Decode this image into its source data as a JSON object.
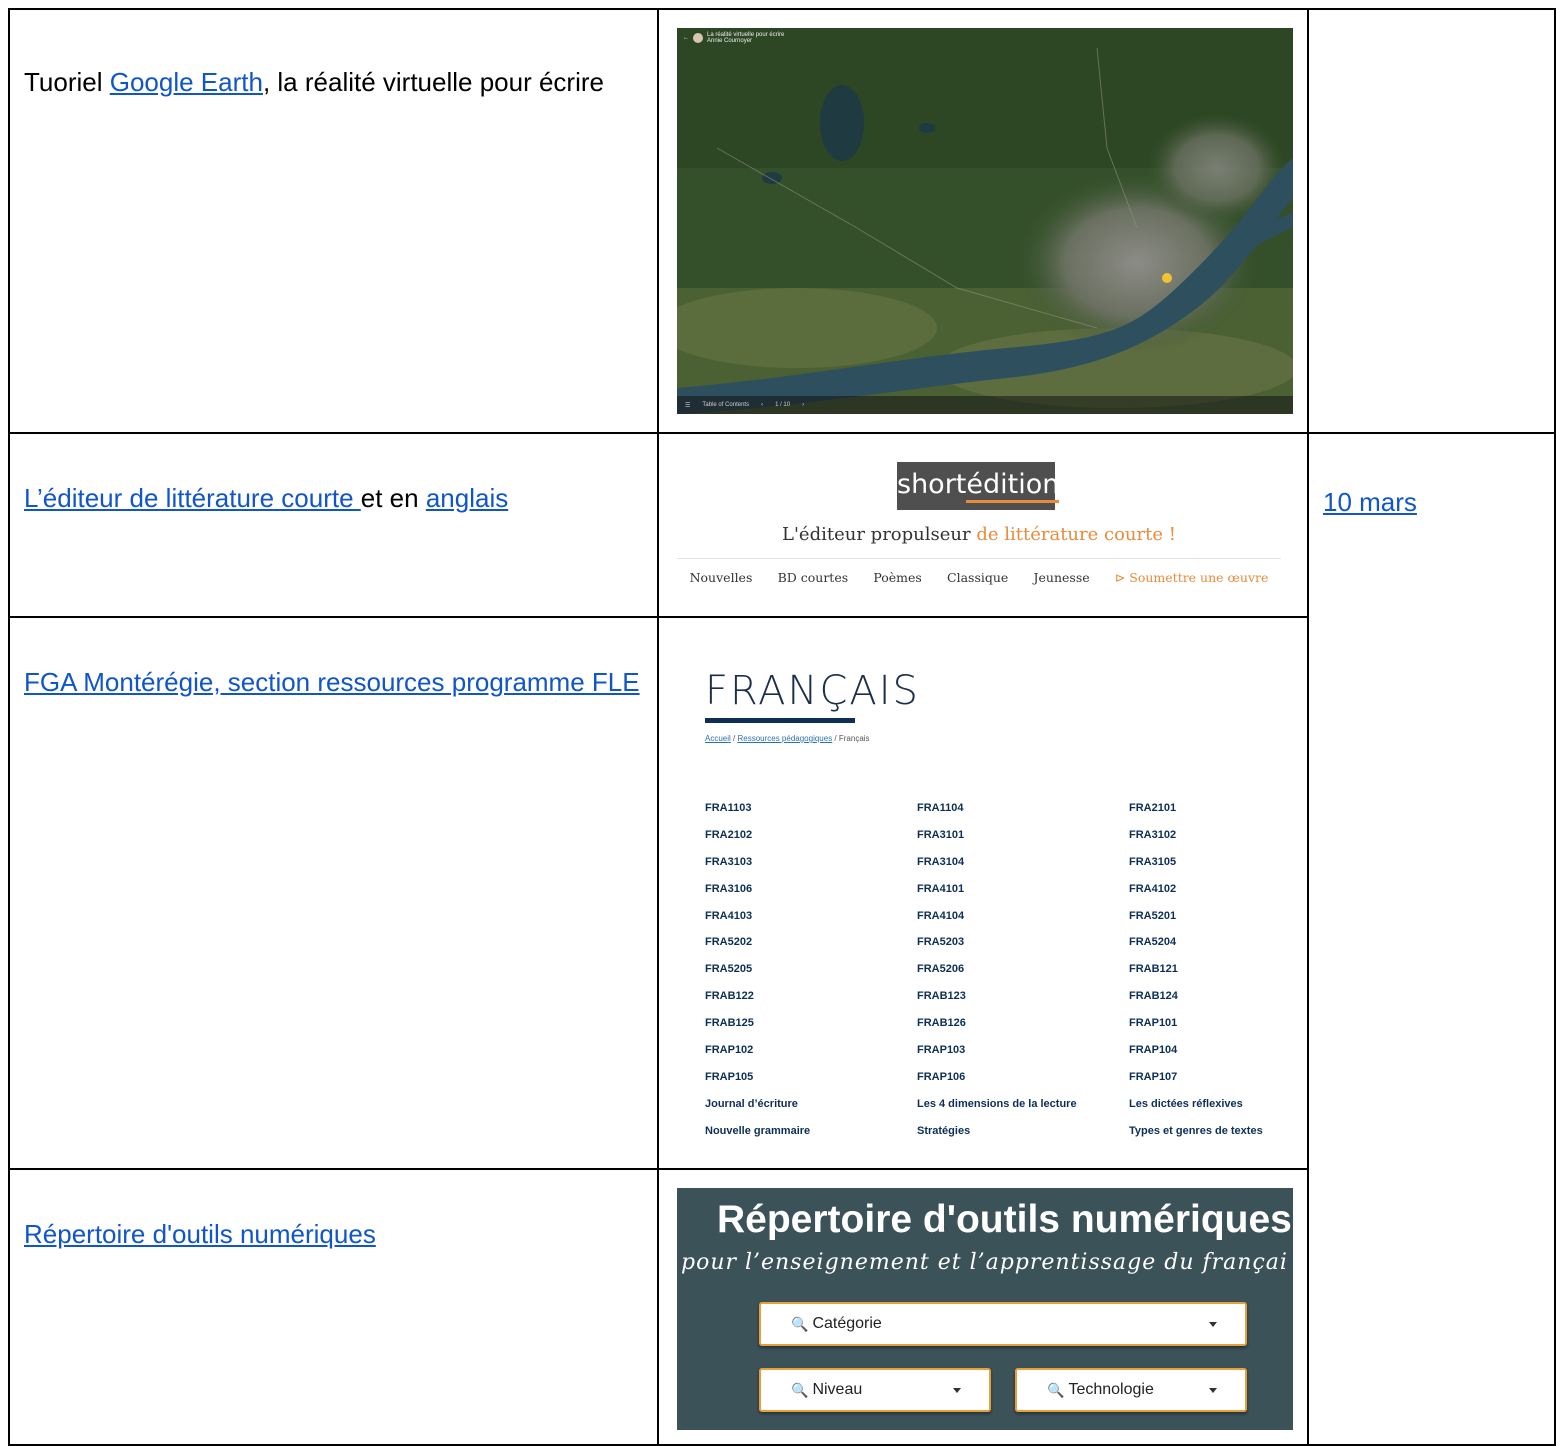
{
  "rows": [
    {
      "text_parts": [
        {
          "text": "Tuoriel ",
          "link": false
        },
        {
          "text": "Google Earth",
          "link": true
        },
        {
          "text": ", la réalité virtuelle pour écrire",
          "link": false
        }
      ],
      "earth": {
        "header_title": "La réalité virtuelle pour écrire",
        "header_author": "Annie Cournoyer",
        "footer_left": "Table of Contents",
        "footer_page": "1 / 10"
      },
      "date": ""
    },
    {
      "text_parts": [
        {
          "text": "L’éditeur de littérature courte ",
          "link": true
        },
        {
          "text": "et en ",
          "link": false
        },
        {
          "text": "anglais",
          "link": true
        }
      ],
      "shortedition": {
        "logo_a": "short",
        "logo_b": "édition",
        "tagline_a": "L'éditeur propulseur ",
        "tagline_b": "de littérature courte !",
        "nav": [
          "Nouvelles",
          "BD courtes",
          "Poèmes",
          "Classique",
          "Jeunesse",
          "⊳ Soumettre une œuvre"
        ]
      },
      "date": "10 mars"
    },
    {
      "text_parts": [
        {
          "text": "FGA Montérégie, section ressources programme FLE",
          "link": true
        }
      ],
      "fga": {
        "title": "FRANÇAIS",
        "crumb_home": "Accueil",
        "crumb_sep1": " / ",
        "crumb_res": "Ressources pédagogiques",
        "crumb_sep2": " / Français",
        "courses": [
          "FRA1103",
          "FRA1104",
          "FRA2101",
          "FRA2102",
          "FRA3101",
          "FRA3102",
          "FRA3103",
          "FRA3104",
          "FRA3105",
          "FRA3106",
          "FRA4101",
          "FRA4102",
          "FRA4103",
          "FRA4104",
          "FRA5201",
          "FRA5202",
          "FRA5203",
          "FRA5204",
          "FRA5205",
          "FRA5206",
          "FRAB121",
          "FRAB122",
          "FRAB123",
          "FRAB124",
          "FRAB125",
          "FRAB126",
          "FRAP101",
          "FRAP102",
          "FRAP103",
          "FRAP104",
          "FRAP105",
          "FRAP106",
          "FRAP107",
          "Journal d’écriture",
          "Les 4 dimensions de la lecture",
          "Les dictées réflexives",
          "Nouvelle grammaire",
          "Stratégies",
          "Types et genres de textes"
        ]
      }
    },
    {
      "text_parts": [
        {
          "text": "Répertoire d'outils numériques",
          "link": true
        }
      ],
      "repertoire": {
        "title": "Répertoire d'outils numériques",
        "subtitle": "pour l’enseignement et l’apprentissage du françai",
        "select_category": "Catégorie",
        "select_level": "Niveau",
        "select_tech": "Technologie"
      }
    }
  ],
  "colors": {
    "link": "#1155cc",
    "accent_orange": "#e98b3a",
    "fga_navy": "#0d2f57",
    "rep_bg": "#3b5258"
  }
}
